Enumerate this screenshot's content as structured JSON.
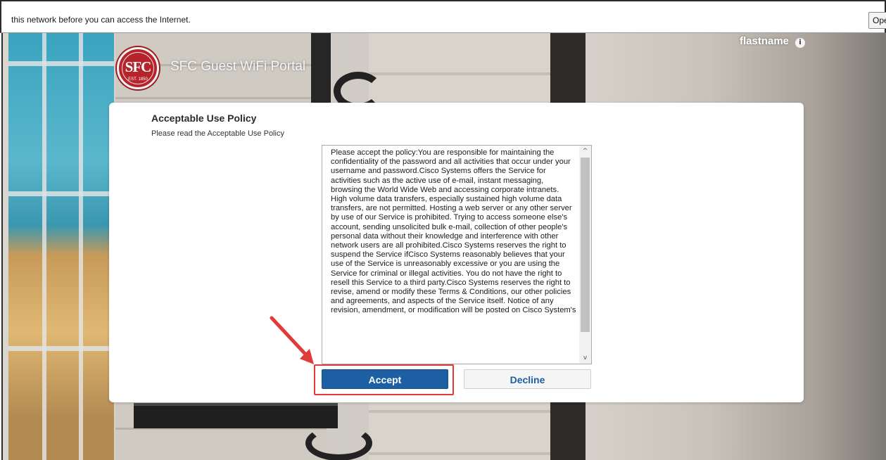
{
  "notification": {
    "message": "this network before you can access the Internet.",
    "open_label": "Ope"
  },
  "portal": {
    "logo_text": "SFC",
    "logo_year": "EST. 1850",
    "title": "SFC Guest WiFi Portal",
    "username": "flastname",
    "info_icon_glyph": "i"
  },
  "policy": {
    "heading": "Acceptable Use Policy",
    "subheading": "Please read the Acceptable Use Policy",
    "body": "Please accept the policy:You are responsible for maintaining the confidentiality of the password and all activities that occur under your username and password.Cisco Systems offers the Service for activities such as the active use of e-mail, instant messaging, browsing the World Wide Web and accessing corporate intranets. High volume data transfers, especially sustained high volume data transfers, are not permitted. Hosting a web server or any other server by use of our Service is prohibited. Trying to access someone else's account, sending unsolicited bulk e-mail, collection of other people's personal data without their knowledge and interference with other network users are all prohibited.Cisco Systems reserves the right to suspend the Service ifCisco Systems reasonably believes that your use of the Service is unreasonably excessive or you are using the Service for criminal or illegal activities. You do not have the right to resell this Service to a third party.Cisco Systems reserves the right to revise, amend or modify these Terms & Conditions, our other policies and agreements, and aspects of the Service itself. Notice of any revision, amendment, or modification will be posted on Cisco System's",
    "scroll_up_glyph": "^",
    "scroll_down_glyph": "v"
  },
  "actions": {
    "accept_label": "Accept",
    "decline_label": "Decline"
  },
  "colors": {
    "accent": "#1d5fa3",
    "annotation": "#e03a3a",
    "logo": "#b5242b"
  },
  "icons": {
    "info": "info-icon",
    "annotation_arrow": "arrow-icon"
  }
}
